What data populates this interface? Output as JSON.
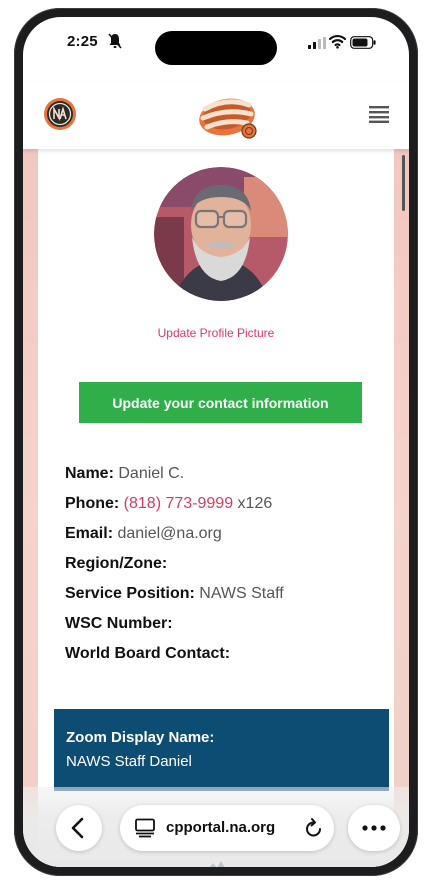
{
  "status_bar": {
    "time": "2:25",
    "icons": [
      "bell-silenced-icon",
      "signal-icon",
      "wifi-icon",
      "battery-icon"
    ]
  },
  "header": {
    "left_logo": "na-logo",
    "center_logo": "our-common-welfare-logo",
    "menu_icon": "hamburger-menu-icon"
  },
  "profile": {
    "avatar": "profile-photo",
    "update_picture_label": "Update Profile Picture",
    "update_contact_label": "Update your contact information"
  },
  "contact": {
    "name_label": "Name:",
    "name_value": "Daniel C.",
    "phone_label": "Phone:",
    "phone_value": "(818) 773-9999",
    "phone_ext": "x126",
    "email_label": "Email:",
    "email_value": "daniel@na.org",
    "region_label": "Region/Zone:",
    "service_label": "Service Position:",
    "service_value": "NAWS Staff",
    "wsc_label": "WSC Number:",
    "world_board_label": "World Board Contact:"
  },
  "zoom": {
    "label": "Zoom Display Name:",
    "value": "NAWS Staff Daniel"
  },
  "browser": {
    "url": "cpportal.na.org",
    "back_icon": "chevron-left-icon",
    "tabs_icon": "tabs-icon",
    "reload_icon": "reload-icon",
    "more_icon": "more-dots-icon"
  },
  "colors": {
    "accent_pink": "#d63a63",
    "button_green": "#2fae4a",
    "zoom_box_blue": "#0d4d73",
    "page_bg": "#f2c7bf"
  }
}
